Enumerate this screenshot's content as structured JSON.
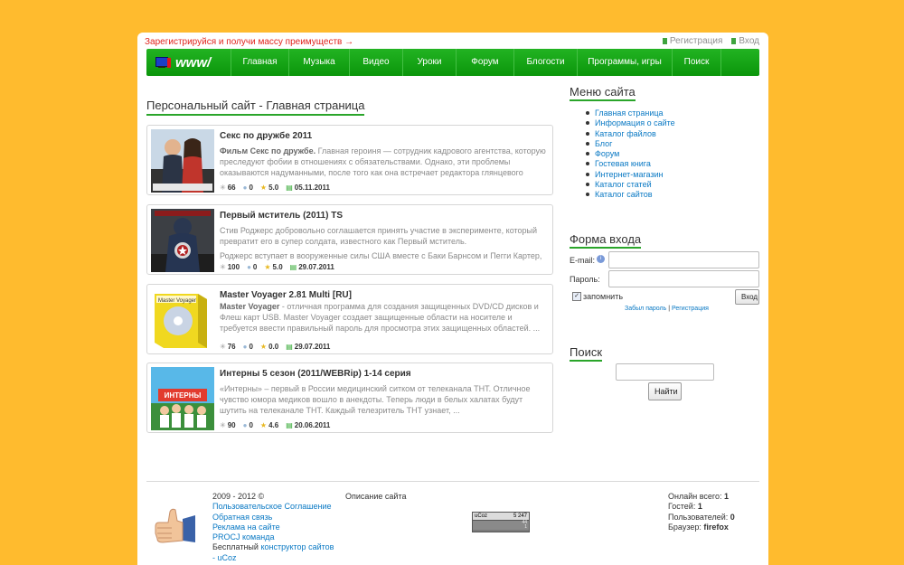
{
  "topbar": {
    "promo": "Зарегистрируйся и получи массу преимуществ →",
    "register": "Регистрация",
    "login": "Вход"
  },
  "nav": {
    "logo_text": "www/",
    "items": [
      "Главная",
      "Музыка",
      "Видео",
      "Уроки",
      "Форум",
      "Блогости",
      "Программы, игры",
      "Поиск"
    ]
  },
  "main": {
    "title": "Персональный сайт - Главная страница",
    "entries": [
      {
        "title": "Секс по дружбе 2011",
        "lead": "Фильм Секс по дружбе.",
        "text": " Главная героиня — сотрудник кадрового агентства, которую преследуют фобии в отношениях с обязательствами. Однако, эти проблемы оказываются надуманными, после того как она встречает редактора глянцевого",
        "views": "66",
        "comments": "0",
        "rating": "5.0",
        "date": "05.11.2011"
      },
      {
        "title": "Первый мститель (2011) TS",
        "text": "Стив Роджерс добровольно соглашается принять участие в эксперименте, который превратит его в супер солдата, известного как Первый мститель.",
        "text2": "Роджерс вступает в вооруженные силы США вместе с Баки Барнсом и Пегги Картер,",
        "views": "100",
        "comments": "0",
        "rating": "5.0",
        "date": "29.07.2011"
      },
      {
        "title": "Master Voyager 2.81 Multi [RU]",
        "lead": "Master Voyager",
        "text": " - отличная программа для создания защищенных DVD/CD дисков и Флеш карт USB. Master Voyager создает защищенные области на носителе и требуется ввести правильный пароль для просмотра этих защищенных областей.  ...",
        "box_label": "Master Voyager",
        "views": "76",
        "comments": "0",
        "rating": "0.0",
        "date": "29.07.2011"
      },
      {
        "title": "Интерны 5 сезон (2011/WEBRip) 1-14 серия",
        "text": "«Интерны» – первый в России медицинский ситком от телеканала ТНТ. Отличное чувство юмора медиков вошло в анекдоты. Теперь люди в белых халатах будут шутить на телеканале ТНТ. Каждый телезритель ТНТ узнает, ...",
        "poster_label": "ИНТЕРНЫ",
        "views": "90",
        "comments": "0",
        "rating": "4.6",
        "date": "20.06.2011"
      }
    ]
  },
  "sidebar": {
    "menu_title": "Меню сайта",
    "menu": [
      "Главная страница",
      "Информация о сайте",
      "Каталог файлов",
      "Блог",
      "Форум",
      "Гостевая книга",
      "Интернет-магазин",
      "Каталог статей",
      "Каталог сайтов"
    ],
    "login_title": "Форма входа",
    "email_label": "E-mail:",
    "password_label": "Пароль:",
    "remember_label": "запомнить",
    "login_button": "Вход",
    "forgot_link": "Забыл пароль",
    "separator": "|",
    "register_link": "Регистрация",
    "search_title": "Поиск",
    "search_button": "Найти"
  },
  "footer": {
    "copyright": "2009 - 2012 ©",
    "links": [
      "Пользовательское Соглашение",
      "Обратная связь",
      "Реклама на сайте",
      "PROCJ команда"
    ],
    "builder_prefix": "Бесплатный",
    "builder_link": "конструктор сайтов",
    "ucoz_link": "- uCoz",
    "site_desc": "Описание сайта",
    "counter": {
      "brand": "uCoz",
      "total": "5 247",
      "hits": "44",
      "hosts": "1"
    },
    "stats": [
      {
        "label": "Онлайн всего:",
        "value": "1"
      },
      {
        "label": "Гостей:",
        "value": "1"
      },
      {
        "label": "Пользователей:",
        "value": "0"
      },
      {
        "label": "Браузер:",
        "value": "firefox"
      }
    ]
  },
  "colors": {
    "accent": "#0b960b",
    "background": "#ffbb2e",
    "link": "#0a79c4",
    "promo": "#e0221b"
  }
}
